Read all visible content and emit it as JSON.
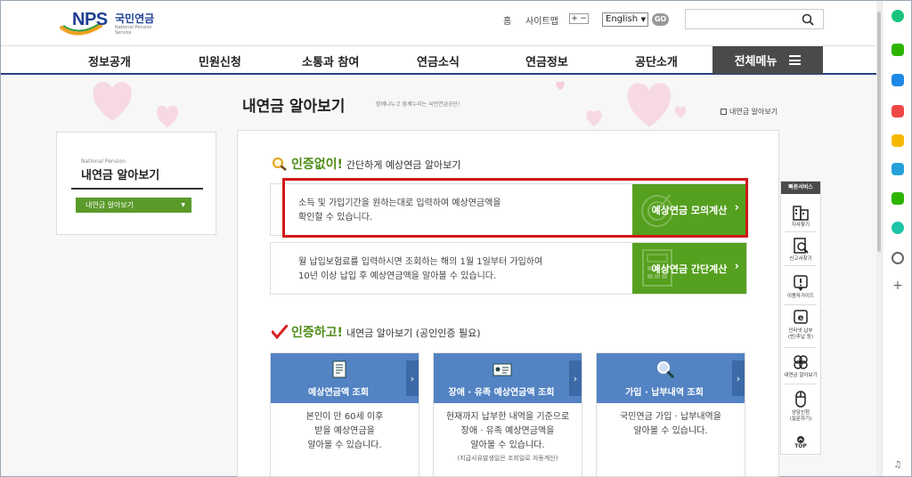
{
  "header": {
    "logo_nps": "NPS",
    "logo_kr": "국민연금",
    "logo_sub": "National Pension Service",
    "util_home": "홈",
    "util_sitemap": "사이트맵",
    "zoom_in": "+",
    "zoom_out": "−",
    "lang_value": "English",
    "go_label": "GO",
    "search_placeholder": ""
  },
  "nav": {
    "items": [
      "정보공개",
      "민원신청",
      "소통과 참여",
      "연금소식",
      "연금정보",
      "공단소개"
    ],
    "all_menu": "전체메뉴"
  },
  "page": {
    "title": "내연금 알아보기",
    "slogan": "함께나누고 함께누리는 국민연금공단!",
    "crumb": "내연금 알아보기"
  },
  "lnb": {
    "en": "National Pension",
    "title": "내연금 알아보기",
    "button": "내연금 알아보기"
  },
  "section1": {
    "em": "인증없이!",
    "rest": "간단하게 예상연금 알아보기",
    "rows": [
      {
        "text1": "소득 및 가입기간을 원하는대로 입력하여 예상연금액을",
        "text2": "확인할 수 있습니다.",
        "button": "예상연금 모의계산"
      },
      {
        "text1": "월 납입보험료를 입력하시면 조회하는 해의 1월 1일부터 가입하여",
        "text2": "10년 이상 납입 후 예상연금액을 알아볼 수 있습니다.",
        "button": "예상연금 간단계산"
      }
    ]
  },
  "section2": {
    "em": "인증하고!",
    "rest": "내연금 알아보기 (공인인증 필요)",
    "cards": [
      {
        "title": "예상연금액 조회",
        "l1": "본인이 만 60세 이후",
        "l2": "받을 예상연금을",
        "l3": "알아볼 수 있습니다.",
        "note": ""
      },
      {
        "title": "장애 · 유족 예상연금액 조회",
        "l1": "현재까지 납부한 내역을 기준으로",
        "l2": "장애  · 유족 예상연금액을",
        "l3": "알아볼 수 있습니다.",
        "note": "(지급사유발생일은 조회일로 자동계산)"
      },
      {
        "title": "가입 · 납부내역 조회",
        "l1": "국민연금 가입  · 납부내역을",
        "l2": "알아볼 수 있습니다.",
        "l3": "",
        "note": ""
      }
    ]
  },
  "quick": {
    "head": "빠른서비스",
    "items": [
      {
        "label1": "지사찾기",
        "label2": ""
      },
      {
        "label1": "신고서찾기",
        "label2": ""
      },
      {
        "label1": "이용자가이드",
        "label2": ""
      },
      {
        "label1": "인터넷 납부",
        "label2": "(반/추납 등)"
      },
      {
        "label1": "내연금 알아보기",
        "label2": ""
      },
      {
        "label1": "상담신청",
        "label2": "(질문하기)"
      }
    ],
    "top": "TOP"
  },
  "colors": {
    "green": "#55a01e",
    "blue": "#5383c3",
    "navy": "#1f3f93",
    "highlight": "#d01818"
  }
}
